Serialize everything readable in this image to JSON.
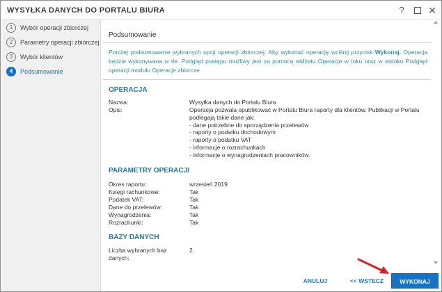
{
  "window": {
    "title": "WYSYŁKA DANYCH DO PORTALU BIURA",
    "help_glyph": "?",
    "close_glyph": "✕"
  },
  "steps": [
    {
      "num": "1",
      "label": "Wybór operacji zbiorczej",
      "active": false
    },
    {
      "num": "2",
      "label": "Parametry operacji zbiorczej",
      "active": false
    },
    {
      "num": "3",
      "label": "Wybór klientów",
      "active": false
    },
    {
      "num": "4",
      "label": "Podsumowanie",
      "active": true
    }
  ],
  "main": {
    "title": "Podsumowanie",
    "intro_before": "Poniżej podsumowanie wybranych opcji operacji zbiorczej. Aby wykonać operację wciśnij przycisk ",
    "intro_bold": "Wykonaj.",
    "intro_after": " Operacja będzie wykonywana w tle. Podgląd postępu możliwy jest za pomocą widżetu Operacje w toku oraz w widoku Podgląd operacji modułu Operacje zbiorcze."
  },
  "sections": {
    "operation": {
      "heading": "OPERACJA",
      "name_label": "Nazwa:",
      "name_value": "Wysyłka danych do Portalu Biura",
      "desc_label": "Opis:",
      "desc_lines": [
        "Operacja pozwala opublikować w Portalu Biura raporty dla klientów. Publikacji w Portalu",
        "podlegają takie dane jak:",
        "- dane potrzebne do sporządzenia przelewów",
        "- raporty o podatku dochodowym",
        "- raporty o podatku VAT",
        "- informacje o rozrachunkach",
        "- informacje o wynagrodzeniach pracowników."
      ]
    },
    "params": {
      "heading": "PARAMETRY OPERACJI",
      "rows": [
        {
          "label": "Okres raportu:",
          "value": "wrzesień 2019"
        },
        {
          "label": "Księgi rachunkowe:",
          "value": "Tak"
        },
        {
          "label": "Podatek VAT:",
          "value": "Tak"
        },
        {
          "label": "Dane do przelewów:",
          "value": "Tak"
        },
        {
          "label": "Wynagrodzenia:",
          "value": "Tak"
        },
        {
          "label": "Rozrachunki:",
          "value": "Tak"
        }
      ]
    },
    "databases": {
      "heading": "BAZY DANYCH",
      "count_label_1": "Liczba wybranych baz",
      "count_label_2": "danych:",
      "count_value": "2"
    }
  },
  "footer": {
    "cancel_label": "ANULUJ",
    "back_label": "<< WSTECZ",
    "execute_label": "WYKONAJ"
  },
  "colors": {
    "accent": "#1473c8",
    "section_heading": "#1f79b4",
    "intro_text": "#2b8fa8",
    "arrow": "#e02020"
  }
}
